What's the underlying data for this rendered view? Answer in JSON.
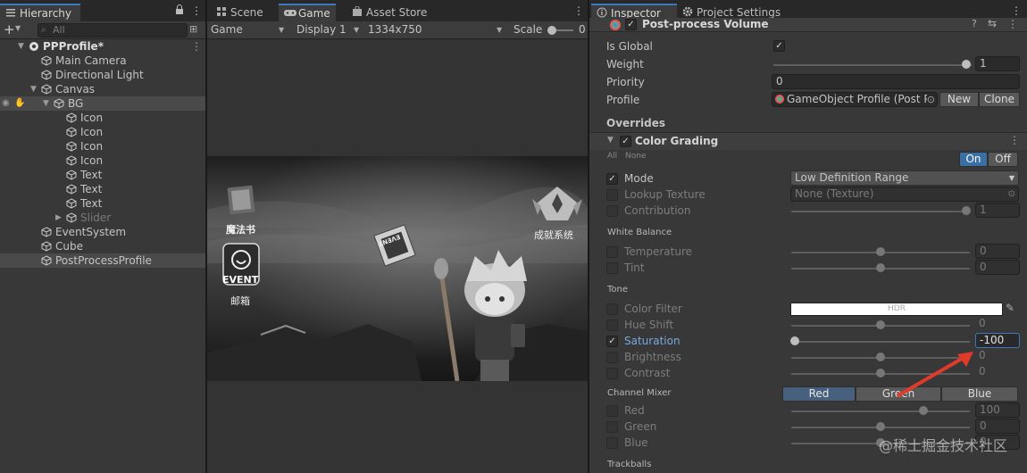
{
  "hierarchy": {
    "tab": "Hierarchy",
    "search_placeholder": "All",
    "scene_name": "PPProfile*",
    "items": [
      {
        "label": "Main Camera"
      },
      {
        "label": "Directional Light"
      },
      {
        "label": "Canvas"
      },
      {
        "label": "BG"
      },
      {
        "label": "Icon"
      },
      {
        "label": "Icon"
      },
      {
        "label": "Icon"
      },
      {
        "label": "Icon"
      },
      {
        "label": "Text"
      },
      {
        "label": "Text"
      },
      {
        "label": "Text"
      },
      {
        "label": "Slider"
      },
      {
        "label": "EventSystem"
      },
      {
        "label": "Cube"
      },
      {
        "label": "PostProcessProfile"
      }
    ]
  },
  "game_view": {
    "tabs": [
      "Scene",
      "Game",
      "Asset Store"
    ],
    "mode": "Game",
    "display": "Display 1",
    "resolution": "1334x750",
    "scale_label": "Scale",
    "scale_value": "0",
    "ui": {
      "book_label": "魔法书",
      "mail_label": "邮箱",
      "event_text": "EVENT",
      "achievement_label": "成就系统",
      "dice_text": "EVENT"
    }
  },
  "inspector": {
    "tabs": [
      "Inspector",
      "Project Settings"
    ],
    "component": "Post-process Volume",
    "is_global_label": "Is Global",
    "weight_label": "Weight",
    "weight_value": "1",
    "priority_label": "Priority",
    "priority_value": "0",
    "profile_label": "Profile",
    "profile_value": "GameObject Profile (Post Pr",
    "new_label": "New",
    "clone_label": "Clone",
    "overrides_label": "Overrides",
    "color_grading": "Color Grading",
    "all_label": "All",
    "none_label": "None",
    "on_label": "On",
    "off_label": "Off",
    "mode_label": "Mode",
    "mode_value": "Low Definition Range",
    "lookup_label": "Lookup Texture",
    "lookup_value": "None (Texture)",
    "contribution_label": "Contribution",
    "contribution_value": "1",
    "white_balance": "White Balance",
    "temperature_label": "Temperature",
    "temperature_value": "0",
    "tint_label": "Tint",
    "tint_value": "0",
    "tone": "Tone",
    "color_filter_label": "Color Filter",
    "hdr_label": "HDR",
    "hue_shift_label": "Hue Shift",
    "hue_shift_value": "0",
    "saturation_label": "Saturation",
    "saturation_value": "-100",
    "brightness_label": "Brightness",
    "brightness_value": "0",
    "contrast_label": "Contrast",
    "contrast_value": "0",
    "channel_mixer": "Channel Mixer",
    "mixer_tabs": [
      "Red",
      "Green",
      "Blue"
    ],
    "mix_red_label": "Red",
    "mix_red_value": "100",
    "mix_green_label": "Green",
    "mix_green_value": "0",
    "mix_blue_label": "Blue",
    "mix_blue_value": "0",
    "trackballs": "Trackballs"
  },
  "watermark": "@稀土掘金技术社区",
  "colors": {
    "accent": "#3a79bb",
    "arrow": "#e03a2a"
  }
}
